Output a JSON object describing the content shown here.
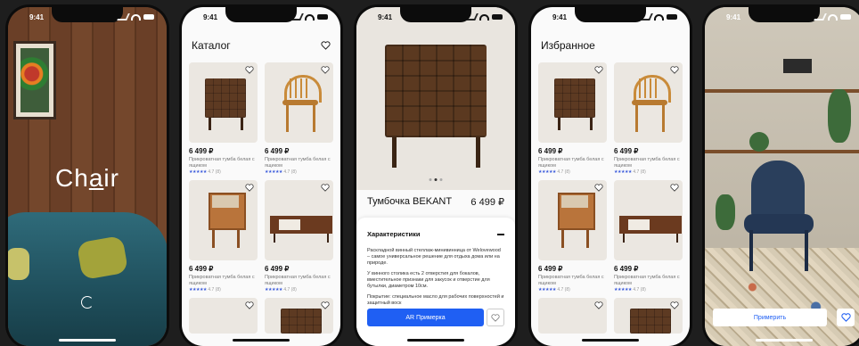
{
  "status_time": "9:41",
  "splash": {
    "logo_prefix": "Ch",
    "logo_accent": "a",
    "logo_suffix": "ir"
  },
  "catalog": {
    "title": "Каталог",
    "items": [
      {
        "price": "6 499 ₽",
        "desc": "Прикроватная тумба белая с ящиком",
        "stars": "★★★★★",
        "rating": "4.7 (8)"
      },
      {
        "price": "6 499 ₽",
        "desc": "Прикроватная тумба белая с ящиком",
        "stars": "★★★★★",
        "rating": "4.7 (8)"
      },
      {
        "price": "6 499 ₽",
        "desc": "Прикроватная тумба белая с ящиком",
        "stars": "★★★★★",
        "rating": "4.7 (8)"
      },
      {
        "price": "6 499 ₽",
        "desc": "Прикроватная тумба белая с ящиком",
        "stars": "★★★★★",
        "rating": "4.7 (8)"
      }
    ]
  },
  "product": {
    "title": "Тумбочка BEKANT",
    "price": "6 499 ₽",
    "section": "Характеристики",
    "p1": "Раскладной винный стеллаж-минивинница от Welovewood – самое универсальное решение для отдыха дома или на природе.",
    "p2": "У винного столика есть 2 отверстия для бокалов, вместительное признаки для закусок и отверстие для бутылки, диаметром 10см.",
    "p3": "Покрытие: специальное масло для рабочих поверхностей и защитный воск",
    "cta": "AR Примерка"
  },
  "favorites": {
    "title": "Избранное",
    "items": [
      {
        "price": "6 499 ₽",
        "desc": "Прикроватная тумба белая с ящиком",
        "stars": "★★★★★",
        "rating": "4.7 (8)"
      },
      {
        "price": "6 499 ₽",
        "desc": "Прикроватная тумба белая с ящиком",
        "stars": "★★★★★",
        "rating": "4.7 (8)"
      },
      {
        "price": "6 499 ₽",
        "desc": "Прикроватная тумба белая с ящиком",
        "stars": "★★★★★",
        "rating": "4.7 (8)"
      },
      {
        "price": "6 499 ₽",
        "desc": "Прикроватная тумба белая с ящиком",
        "stars": "★★★★★",
        "rating": "4.7 (8)"
      }
    ]
  },
  "ar": {
    "cta": "Примерить"
  },
  "colors": {
    "accent": "#1f5ff3",
    "star": "#3b5bdb"
  }
}
